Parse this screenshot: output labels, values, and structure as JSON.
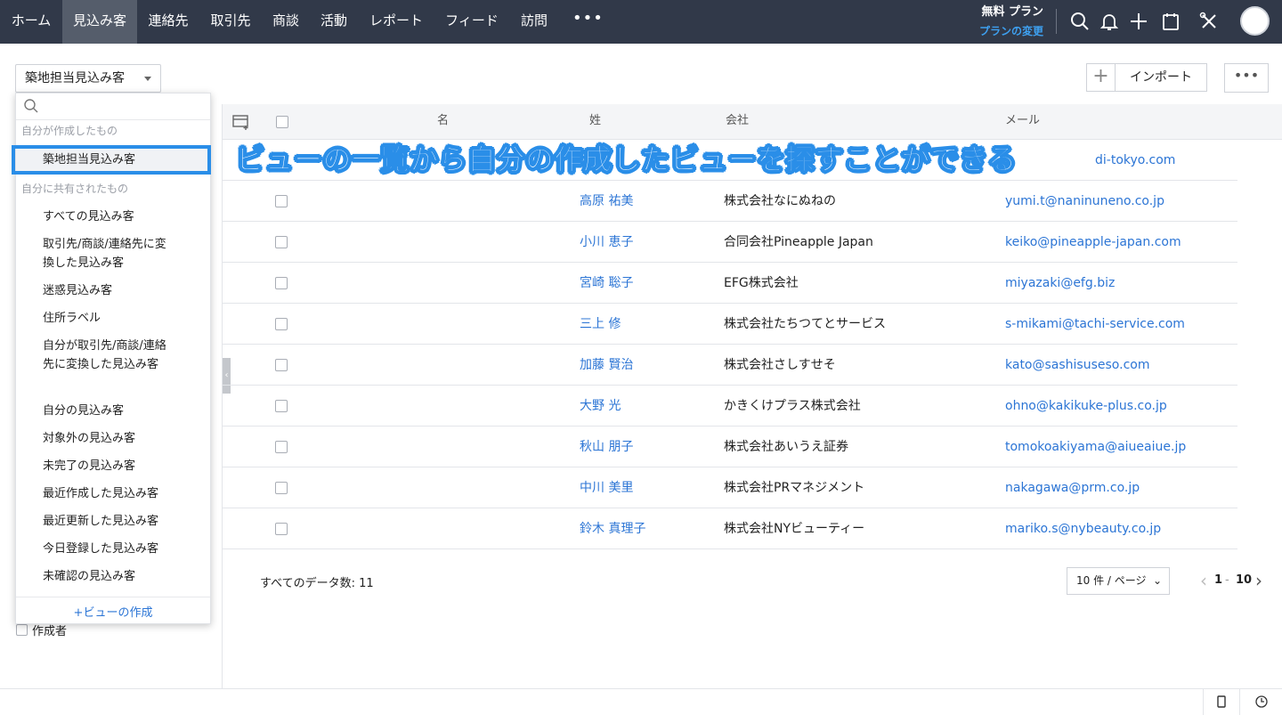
{
  "nav": {
    "tabs": [
      "ホーム",
      "見込み客",
      "連絡先",
      "取引先",
      "商談",
      "活動",
      "レポート",
      "フィード",
      "訪問"
    ],
    "active": "見込み客",
    "more": "•••",
    "plan": "無料 プラン",
    "plan_link": "プランの変更"
  },
  "toolbar": {
    "view_selected": "築地担当見込み客",
    "plus_label": "+",
    "import_label": "インポート",
    "more_label": "•••"
  },
  "dropdown": {
    "search_placeholder": "",
    "group_mine": "自分が作成したもの",
    "mine": [
      "築地担当見込み客"
    ],
    "group_shared": "自分に共有されたもの",
    "shared": [
      "すべての見込み客",
      "取引先/商談/連絡先に変換した見込み客",
      "迷惑見込み客",
      "住所ラベル",
      "自分が取引先/商談/連絡先に変換した見込み客",
      "自分の見込み客",
      "対象外の見込み客",
      "未完了の見込み客",
      "最近作成した見込み客",
      "最近更新した見込み客",
      "今日登録した見込み客",
      "未確認の見込み客"
    ],
    "create_label": "+ビューの作成"
  },
  "filter": {
    "creator_label": "作成者"
  },
  "table": {
    "headers": {
      "first": "名",
      "last": "姓",
      "company": "会社",
      "email": "メール"
    },
    "first_row_partial": {
      "email": "di-tokyo.com"
    },
    "rows": [
      {
        "name": "高原 祐美",
        "company": "株式会社なにぬねの",
        "email": "yumi.t@naninuneno.co.jp"
      },
      {
        "name": "小川 恵子",
        "company": "合同会社Pineapple Japan",
        "email": "keiko@pineapple-japan.com"
      },
      {
        "name": "宮崎 聡子",
        "company": "EFG株式会社",
        "email": "miyazaki@efg.biz"
      },
      {
        "name": "三上 修",
        "company": "株式会社たちつてとサービス",
        "email": "s-mikami@tachi-service.com"
      },
      {
        "name": "加藤 賢治",
        "company": "株式会社さしすせそ",
        "email": "kato@sashisuseso.com"
      },
      {
        "name": "大野 光",
        "company": "かきくけプラス株式会社",
        "email": "ohno@kakikuke-plus.co.jp"
      },
      {
        "name": "秋山 朋子",
        "company": "株式会社あいうえ証券",
        "email": "tomokoakiyama@aiueaiue.jp"
      },
      {
        "name": "中川 美里",
        "company": "株式会社PRマネジメント",
        "email": "nakagawa@prm.co.jp"
      },
      {
        "name": "鈴木 真理子",
        "company": "株式会社NYビューティー",
        "email": "mariko.s@nybeauty.co.jp"
      }
    ],
    "total_label": "すべてのデータ数: 11",
    "per_page": "10 件 / ページ",
    "page_start": "1",
    "page_sep": "-",
    "page_end": "10"
  },
  "annotation": "ビューの一覧から自分の作成したビューを探すことができる",
  "colors": {
    "nav_bg": "#313949",
    "accent_blue": "#2a8ee8",
    "link": "#2c75d5"
  }
}
